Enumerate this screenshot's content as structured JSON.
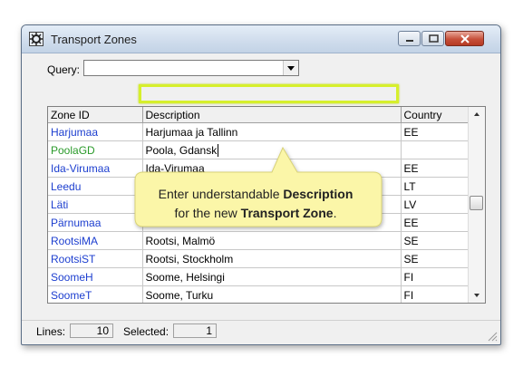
{
  "window": {
    "title": "Transport Zones"
  },
  "query": {
    "label": "Query:",
    "value": ""
  },
  "table": {
    "columns": [
      "Zone ID",
      "Description",
      "Country"
    ],
    "rows": [
      {
        "zone_id": "Harjumaa",
        "description": "Harjumaa ja Tallinn",
        "country": "EE"
      },
      {
        "zone_id": "PoolaGD",
        "description": "Poola, Gdansk",
        "country": ""
      },
      {
        "zone_id": "Ida-Virumaa",
        "description": "Ida-Virumaa",
        "country": "EE"
      },
      {
        "zone_id": "Leedu",
        "description": "",
        "country": "LT"
      },
      {
        "zone_id": "Läti",
        "description": "",
        "country": "LV"
      },
      {
        "zone_id": "Pärnumaa",
        "description": "",
        "country": "EE"
      },
      {
        "zone_id": "RootsiMA",
        "description": "Rootsi, Malmö",
        "country": "SE"
      },
      {
        "zone_id": "RootsiST",
        "description": "Rootsi, Stockholm",
        "country": "SE"
      },
      {
        "zone_id": "SoomeH",
        "description": "Soome, Helsingi",
        "country": "FI"
      },
      {
        "zone_id": "SoomeT",
        "description": "Soome, Turku",
        "country": "FI"
      }
    ]
  },
  "callout": {
    "line1_prefix": "Enter understandable ",
    "line1_bold": "Description",
    "line2_prefix": "for the new ",
    "line2_bold": "Transport Zone",
    "line2_suffix": "."
  },
  "status": {
    "lines_label": "Lines:",
    "lines_value": "10",
    "selected_label": "Selected:",
    "selected_value": "1"
  },
  "colors": {
    "zone_link": "#1c3ecf",
    "editing_zone": "#2a9a2a",
    "callout_fill": "#fbf6a8",
    "highlight": "#d6ef2c"
  }
}
